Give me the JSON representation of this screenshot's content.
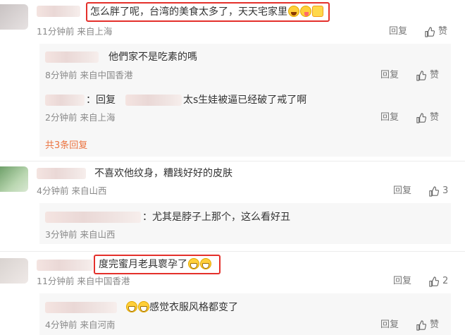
{
  "labels": {
    "reply": "回复",
    "like": "赞"
  },
  "comments": [
    {
      "text": "怎么胖了呢，台湾的美食太多了，天天宅家里",
      "time": "11分钟前",
      "location": "来自上海",
      "likes": "",
      "replies": [
        {
          "text": "他們家不是吃素的嗎",
          "time": "8分钟前",
          "location": "来自中国香港",
          "likes": ""
        },
        {
          "prefix": "：回复",
          "text": "太s生娃被逼已经破了戒了啊",
          "time": "2分钟前",
          "location": "来自上海",
          "likes": ""
        }
      ],
      "more_replies": "共3条回复"
    },
    {
      "text": "不喜欢他纹身，糟践好好的皮肤",
      "time": "4分钟前",
      "location": "来自山西",
      "likes": "3",
      "replies": [
        {
          "prefix": "：",
          "text": "尤其是脖子上那个，这么看好丑",
          "time": "3分钟前",
          "location": "来自山西",
          "likes": ""
        }
      ]
    },
    {
      "text": "度完蜜月老具褱孕了",
      "time": "11分钟前",
      "location": "来自中国香港",
      "likes": "2",
      "replies": [
        {
          "text": "感觉衣服风格都变了",
          "time": "4分钟前",
          "location": "来自河南",
          "likes": ""
        }
      ]
    }
  ],
  "colors": {
    "highlight": "#e4302b",
    "link": "#eb7340"
  }
}
